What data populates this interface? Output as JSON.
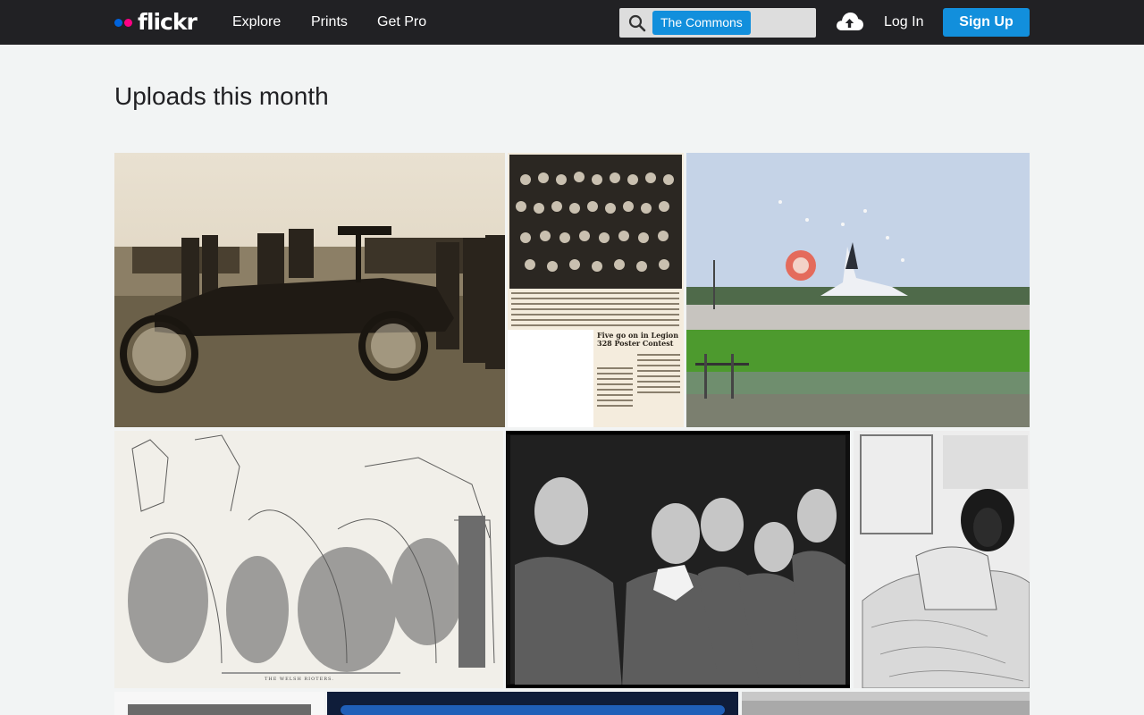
{
  "header": {
    "logo_text": "flickr",
    "nav": [
      {
        "label": "Explore"
      },
      {
        "label": "Prints"
      },
      {
        "label": "Get Pro"
      }
    ],
    "search": {
      "scope_label": "The Commons",
      "placeholder": ""
    },
    "login_label": "Log In",
    "signup_label": "Sign Up"
  },
  "page": {
    "title": "Uploads this month"
  },
  "photos": [
    {
      "subject": "sepia photo of men beside an early automobile with mounted gun"
    },
    {
      "subject": "newspaper clipping with group photo",
      "headline": "Five go on in Legion 328 Poster Contest"
    },
    {
      "subject": "space shuttle landing with drag parachute"
    },
    {
      "subject": "engraving of women with sticks at a gate",
      "caption": "THE WELSH RIOTERS."
    },
    {
      "subject": "black and white photo of excited women in audience"
    },
    {
      "subject": "lithograph of a person lying in bed"
    },
    {
      "subject": "partial photo tile"
    },
    {
      "subject": "partial photo tile"
    },
    {
      "subject": "partial photo tile"
    }
  ],
  "colors": {
    "topbar": "#212124",
    "accent": "#128fdc",
    "logo_blue": "#0063dc",
    "logo_pink": "#ff0084",
    "background": "#f2f4f4"
  }
}
